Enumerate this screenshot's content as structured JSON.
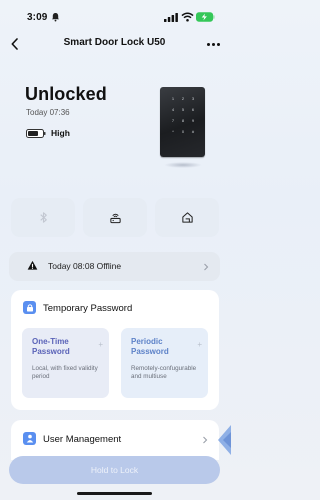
{
  "status_bar": {
    "time": "3:09",
    "icons": [
      "bell-icon",
      "cellular-signal-icon",
      "wifi-icon",
      "battery-charging-icon"
    ]
  },
  "nav": {
    "title": "Smart Door Lock U50",
    "back_icon": "chevron-left-icon",
    "more_icon": "more-horizontal-icon"
  },
  "lock": {
    "state": "Unlocked",
    "time": "Today 07:36",
    "battery_label": "High"
  },
  "actions": [
    {
      "icon": "bluetooth-icon"
    },
    {
      "icon": "gateway-icon"
    },
    {
      "icon": "home-icon"
    }
  ],
  "offline": {
    "text": "Today 08:08 Offline",
    "icon": "warning-icon"
  },
  "temp_password": {
    "title": "Temporary Password",
    "options": [
      {
        "name": "One-Time Password",
        "desc": "Local, with fixed validity period"
      },
      {
        "name": "Periodic Password",
        "desc": "Remotely-confugurable and multiuse"
      }
    ]
  },
  "user_management": {
    "title": "User Management"
  },
  "hold_button": {
    "label": "Hold to Lock"
  },
  "colors": {
    "accent": "#5a8ff0",
    "button_bg": "#b9c9ea"
  }
}
